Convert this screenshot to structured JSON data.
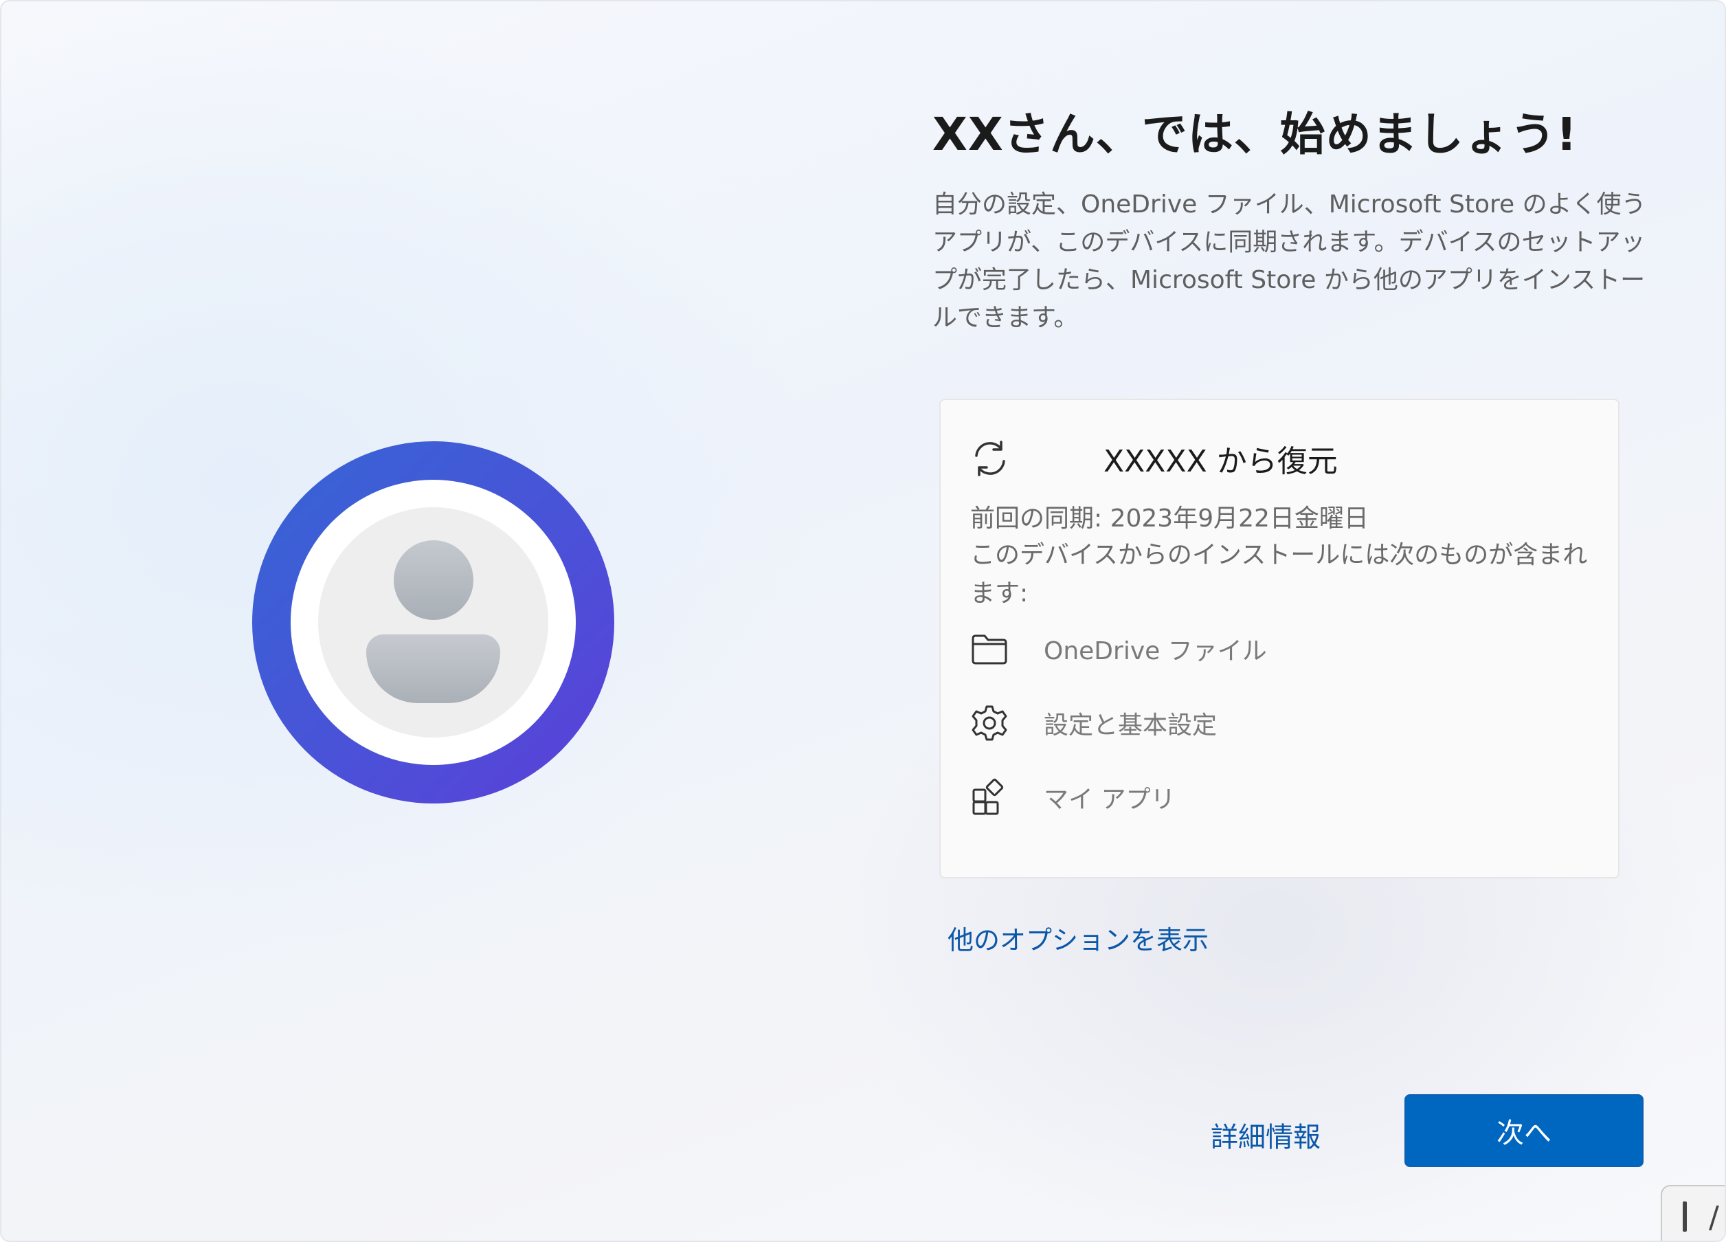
{
  "title": "XXさん、では、始めましょう!",
  "description": "自分の設定、OneDrive ファイル、Microsoft Store のよく使うアプリが、このデバイスに同期されます。デバイスのセットアップが完了したら、Microsoft Store から他のアプリをインストールできます。",
  "avatar": {
    "icon": "user-avatar-icon",
    "ring_gradient": [
      "#3566d4",
      "#5b3fd8"
    ]
  },
  "restore_card": {
    "icon": "sync-icon",
    "title": "XXXXX から復元",
    "last_sync": "前回の同期: 2023年9月22日金曜日",
    "includes_text": "このデバイスからのインストールには次のものが含まれます:",
    "items": [
      {
        "icon": "folder-icon",
        "label": "OneDrive ファイル"
      },
      {
        "icon": "gear-icon",
        "label": "設定と基本設定"
      },
      {
        "icon": "apps-icon",
        "label": "マイ アプリ"
      }
    ]
  },
  "more_options_link": "他のオプションを表示",
  "footer": {
    "details_link": "詳細情報",
    "next_button": "次へ"
  },
  "colors": {
    "accent": "#0067c0",
    "link": "#0b57a8"
  }
}
